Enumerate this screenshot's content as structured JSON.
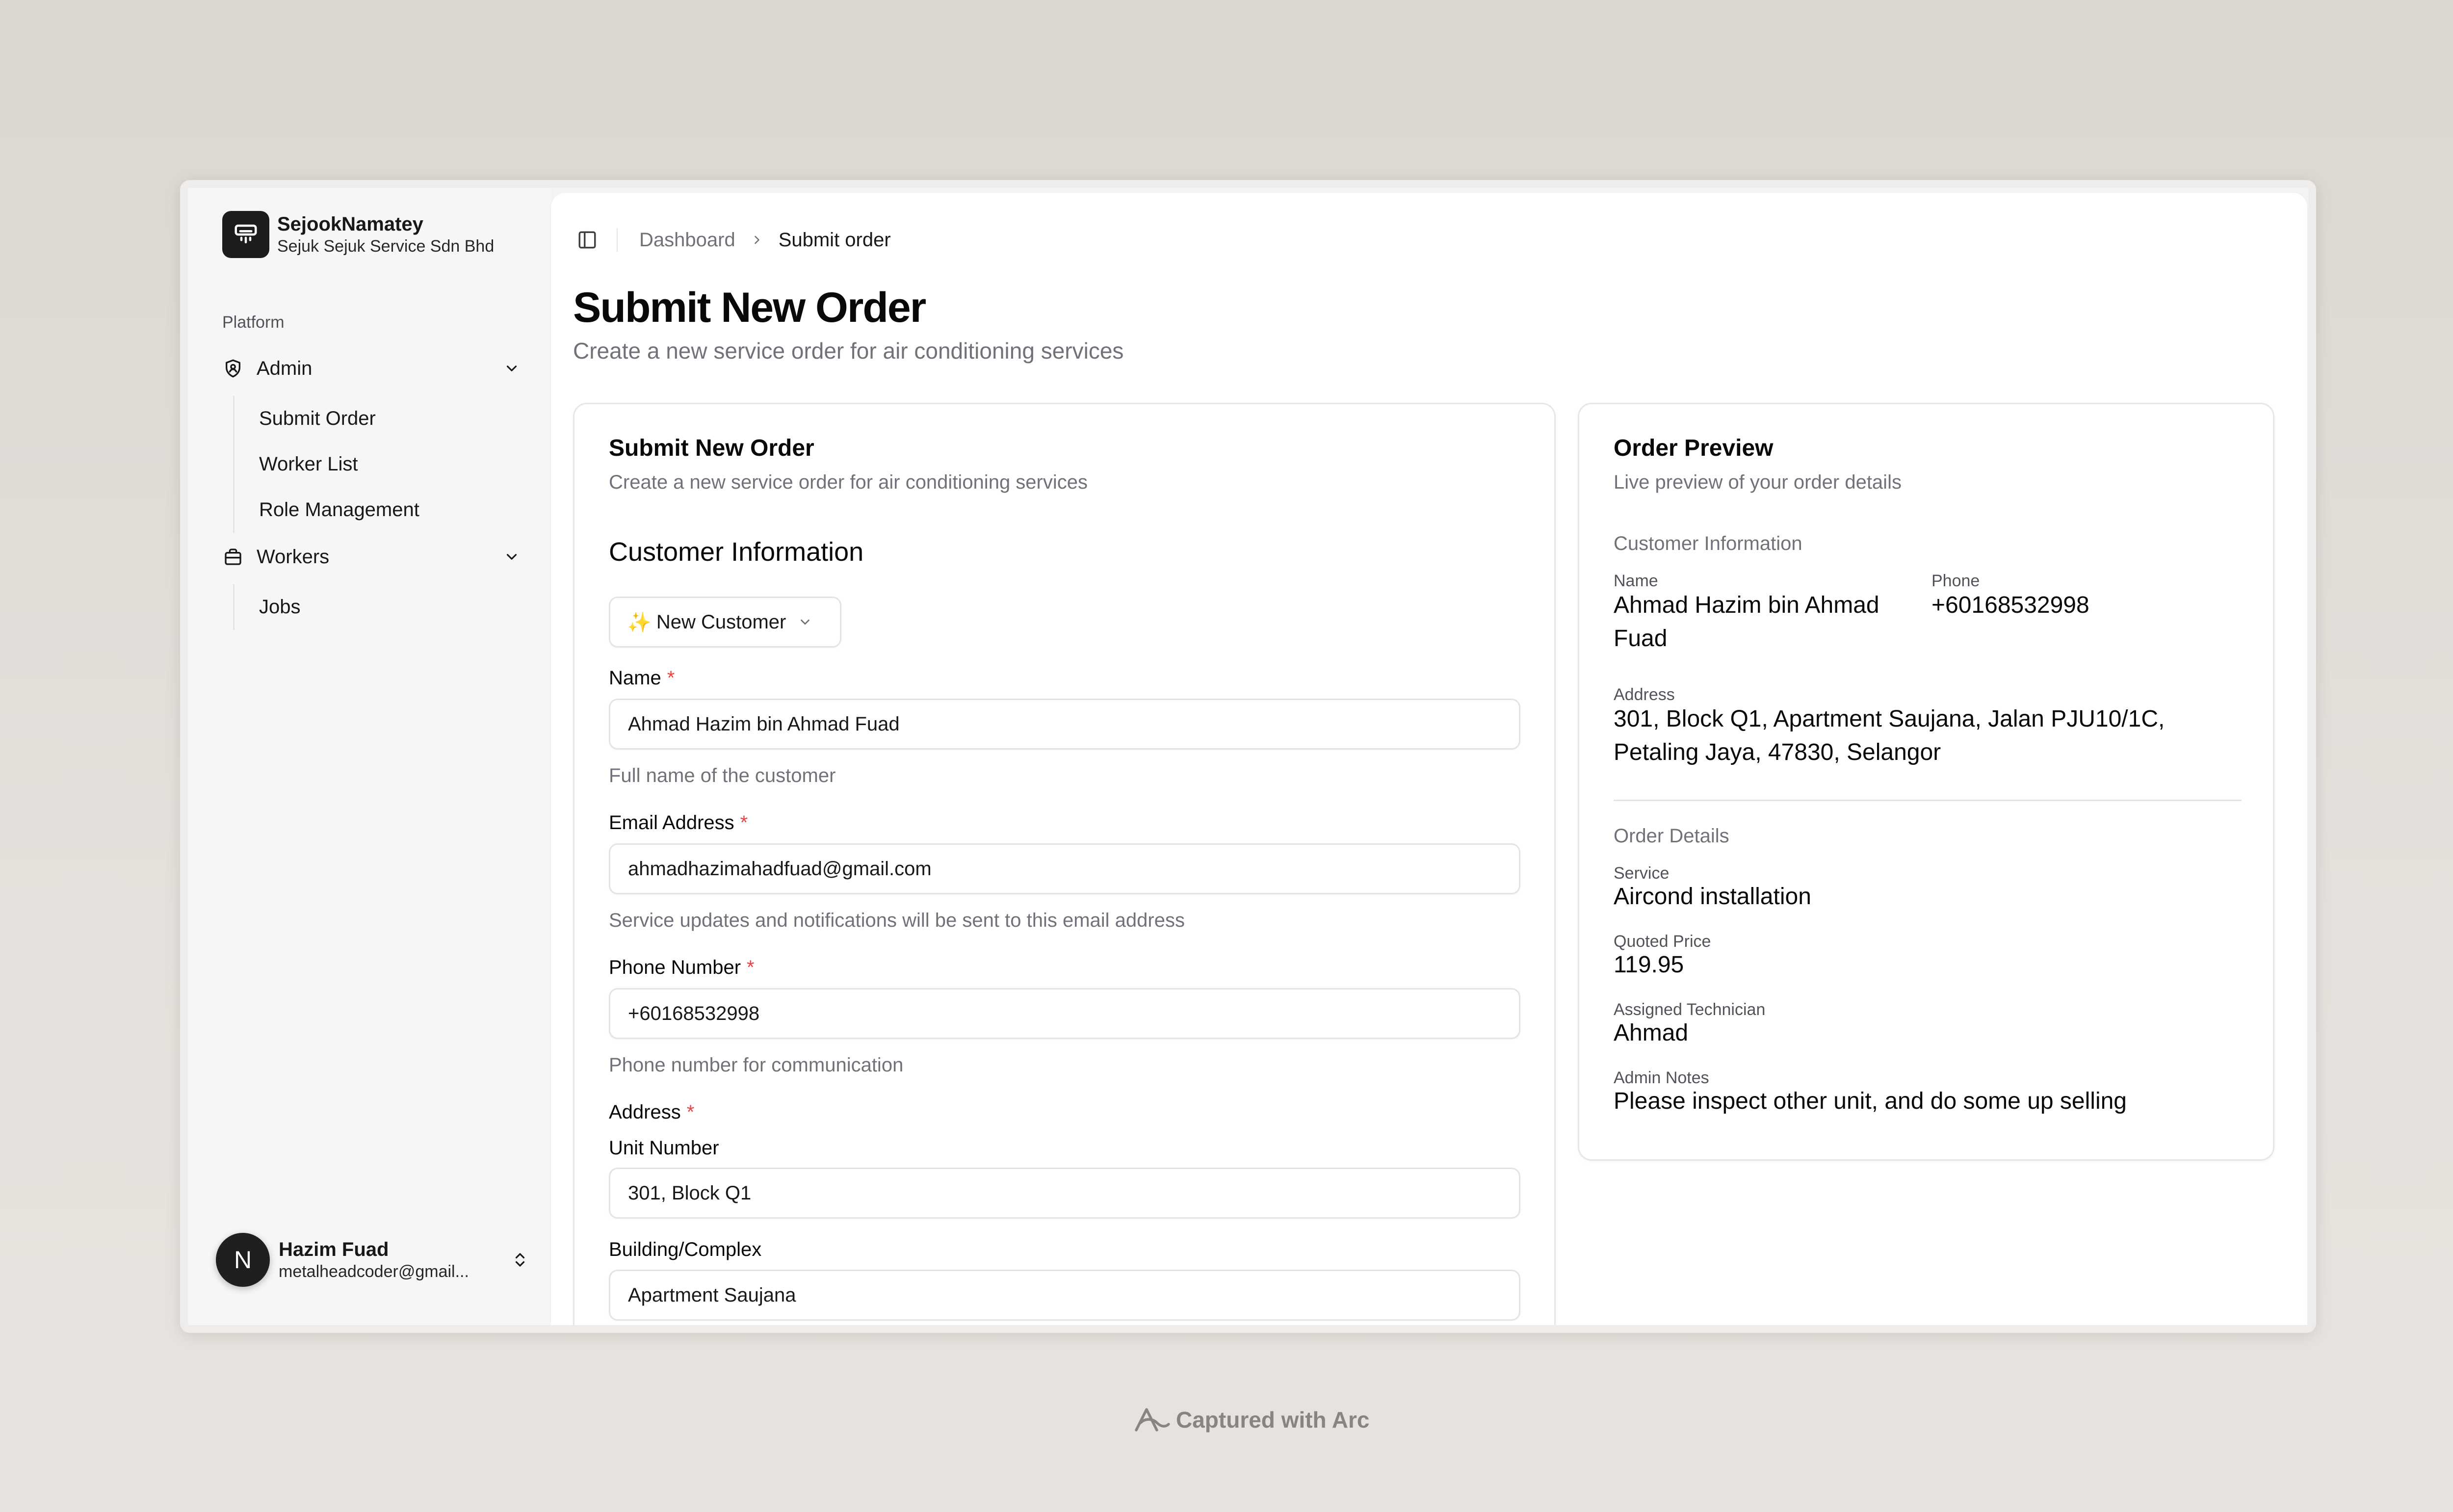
{
  "app": {
    "name": "SejookNamatey",
    "company": "Sejuk Sejuk Service Sdn Bhd"
  },
  "sidebar": {
    "group_label": "Platform",
    "sections": [
      {
        "label": "Admin",
        "icon": "shield-icon",
        "items": [
          "Submit Order",
          "Worker List",
          "Role Management"
        ]
      },
      {
        "label": "Workers",
        "icon": "briefcase-icon",
        "items": [
          "Jobs"
        ]
      }
    ]
  },
  "user": {
    "initial": "N",
    "name": "Hazim Fuad",
    "email": "metalheadcoder@gmail..."
  },
  "breadcrumb": {
    "parent": "Dashboard",
    "current": "Submit order"
  },
  "page": {
    "title": "Submit New Order",
    "subtitle": "Create a new service order for air conditioning services"
  },
  "form": {
    "title": "Submit New Order",
    "description": "Create a new service order for air conditioning services",
    "section_title": "Customer Information",
    "customer_mode": {
      "icon": "✨",
      "label": "New Customer"
    },
    "fields": {
      "name": {
        "label": "Name",
        "value": "Ahmad Hazim bin Ahmad Fuad",
        "help": "Full name of the customer"
      },
      "email": {
        "label": "Email Address",
        "value": "ahmadhazimahadfuad@gmail.com",
        "help": "Service updates and notifications will be sent to this email address"
      },
      "phone": {
        "label": "Phone Number",
        "value": "+60168532998",
        "help": "Phone number for communication"
      },
      "address_label": "Address",
      "unit": {
        "label": "Unit Number",
        "value": "301, Block Q1"
      },
      "building": {
        "label": "Building/Complex",
        "value": "Apartment Saujana"
      }
    },
    "required_mark": "*"
  },
  "preview": {
    "title": "Order Preview",
    "description": "Live preview of your order details",
    "customer_section": "Customer Information",
    "name_label": "Name",
    "name_value_line1": "Ahmad Hazim bin Ahmad",
    "name_value_line2": "Fuad",
    "phone_label": "Phone",
    "phone_value": "+60168532998",
    "address_label": "Address",
    "address_line1": "301, Block Q1, Apartment Saujana, Jalan PJU10/1C,",
    "address_line2": "Petaling Jaya, 47830, Selangor",
    "order_section": "Order Details",
    "service_label": "Service",
    "service_value": "Aircond installation",
    "price_label": "Quoted Price",
    "price_value": "119.95",
    "technician_label": "Assigned Technician",
    "technician_value": "Ahmad",
    "notes_label": "Admin Notes",
    "notes_value": "Please inspect other unit, and do some up selling"
  },
  "caption": "Captured with Arc"
}
